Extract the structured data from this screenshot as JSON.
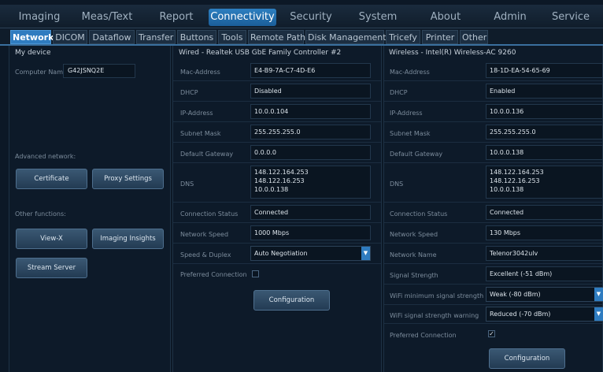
{
  "top_tabs": [
    "Imaging",
    "Meas/Text",
    "Report",
    "Connectivity",
    "Security",
    "System",
    "About",
    "Admin",
    "Service"
  ],
  "sub_tabs": [
    "Network",
    "DICOM",
    "Dataflow",
    "Transfer",
    "Buttons",
    "Tools",
    "Remote Path",
    "Disk Management",
    "Tricefy",
    "Printer",
    "Other"
  ],
  "my_device": {
    "title": "My device",
    "computer_name_label": "Computer Name",
    "computer_name": "G42JSNQ2E",
    "advanced_label": "Advanced network:",
    "certificate": "Certificate",
    "proxy": "Proxy Settings",
    "other_label": "Other functions:",
    "viewx": "View-X",
    "insights": "Imaging Insights",
    "stream": "Stream Server"
  },
  "wired": {
    "title": "Wired - Realtek USB GbE Family Controller #2",
    "labels": {
      "mac": "Mac-Address",
      "dhcp": "DHCP",
      "ip": "IP-Address",
      "subnet": "Subnet Mask",
      "gateway": "Default Gateway",
      "dns": "DNS",
      "status": "Connection Status",
      "speed": "Network Speed",
      "duplex": "Speed & Duplex",
      "preferred": "Preferred Connection"
    },
    "mac": "E4-B9-7A-C7-4D-E6",
    "dhcp": "Disabled",
    "ip": "10.0.0.104",
    "subnet": "255.255.255.0",
    "gateway": "0.0.0.0",
    "dns1": "148.122.164.253",
    "dns2": "148.122.16.253",
    "dns3": "10.0.0.138",
    "status": "Connected",
    "speed": "1000 Mbps",
    "duplex": "Auto Negotiation",
    "configuration": "Configuration"
  },
  "wireless": {
    "title": "Wireless - Intel(R) Wireless-AC 9260",
    "labels": {
      "mac": "Mac-Address",
      "dhcp": "DHCP",
      "ip": "IP-Address",
      "subnet": "Subnet Mask",
      "gateway": "Default Gateway",
      "dns": "DNS",
      "status": "Connection Status",
      "speed": "Network Speed",
      "name": "Network Name",
      "signal": "Signal Strength",
      "min_signal": "WiFi minimum signal strength",
      "warning": "WiFi signal strength warning",
      "preferred": "Preferred Connection"
    },
    "mac": "18-1D-EA-54-65-69",
    "dhcp": "Enabled",
    "ip": "10.0.0.136",
    "subnet": "255.255.255.0",
    "gateway": "10.0.0.138",
    "dns1": "148.122.164.253",
    "dns2": "148.122.16.253",
    "dns3": "10.0.0.138",
    "status": "Connected",
    "speed": "130 Mbps",
    "name": "Telenor3042ulv",
    "signal": "Excellent (-51 dBm)",
    "min_signal": "Weak (-80 dBm)",
    "warning": "Reduced (-70 dBm)",
    "preferred_check": "✓",
    "configuration": "Configuration"
  },
  "colors": {
    "accent": "#2f7cc0",
    "background": "#0c1826"
  }
}
